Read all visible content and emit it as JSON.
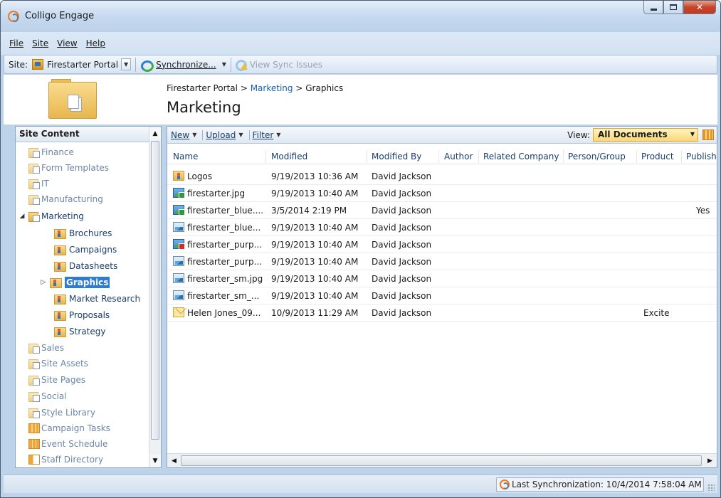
{
  "window": {
    "title": "Colligo Engage"
  },
  "menu": [
    {
      "label": "File"
    },
    {
      "label": "Site"
    },
    {
      "label": "View"
    },
    {
      "label": "Help"
    }
  ],
  "toolbar": {
    "site_label": "Site:",
    "site_value": "Firestarter Portal",
    "synchronize_label": "Synchronize...",
    "view_sync_issues_label": "View Sync Issues"
  },
  "header": {
    "breadcrumb": [
      "Firestarter Portal",
      "Marketing",
      "Graphics"
    ],
    "breadcrumb_sep": ">",
    "title": "Marketing"
  },
  "left_pane": {
    "header": "Site Content",
    "items": [
      {
        "label": "Finance"
      },
      {
        "label": "Form Templates"
      },
      {
        "label": "IT"
      },
      {
        "label": "Manufacturing"
      },
      {
        "label": "Marketing"
      },
      {
        "label": "Brochures"
      },
      {
        "label": "Campaigns"
      },
      {
        "label": "Datasheets"
      },
      {
        "label": "Graphics"
      },
      {
        "label": "Market Research"
      },
      {
        "label": "Proposals"
      },
      {
        "label": "Strategy"
      },
      {
        "label": "Sales"
      },
      {
        "label": "Site Assets"
      },
      {
        "label": "Site Pages"
      },
      {
        "label": "Social"
      },
      {
        "label": "Style Library"
      },
      {
        "label": "Campaign Tasks"
      },
      {
        "label": "Event Schedule"
      },
      {
        "label": "Staff Directory"
      }
    ]
  },
  "commands": {
    "new": "New",
    "upload": "Upload",
    "filter": "Filter",
    "view_label": "View:",
    "view_value": "All Documents"
  },
  "table": {
    "columns": [
      "Name",
      "Modified",
      "Modified By",
      "Author",
      "Related Company",
      "Person/Group",
      "Product",
      "Publish"
    ],
    "rows": [
      {
        "icon": "folder-icon",
        "name": "Logos",
        "modified": "9/19/2013 10:36 AM",
        "modified_by": "David Jackson",
        "product": "",
        "publish": ""
      },
      {
        "icon": "image-file-icon",
        "name": "firestarter.jpg",
        "modified": "9/19/2013 10:40 AM",
        "modified_by": "David Jackson",
        "product": "",
        "publish": ""
      },
      {
        "icon": "image-file-icon",
        "name": "firestarter_blue....",
        "modified": "3/5/2014 2:19 PM",
        "modified_by": "David Jackson",
        "product": "",
        "publish": "Yes"
      },
      {
        "icon": "image-file-icon",
        "name": "firestarter_blue...",
        "modified": "9/19/2013 10:40 AM",
        "modified_by": "David Jackson",
        "product": "",
        "publish": ""
      },
      {
        "icon": "image-file-icon",
        "name": "firestarter_purp...",
        "modified": "9/19/2013 10:40 AM",
        "modified_by": "David Jackson",
        "product": "",
        "publish": ""
      },
      {
        "icon": "image-file-icon",
        "name": "firestarter_purp...",
        "modified": "9/19/2013 10:40 AM",
        "modified_by": "David Jackson",
        "product": "",
        "publish": ""
      },
      {
        "icon": "image-file-icon",
        "name": "firestarter_sm.jpg",
        "modified": "9/19/2013 10:40 AM",
        "modified_by": "David Jackson",
        "product": "",
        "publish": ""
      },
      {
        "icon": "image-file-icon",
        "name": "firestarter_sm_...",
        "modified": "9/19/2013 10:40 AM",
        "modified_by": "David Jackson",
        "product": "",
        "publish": ""
      },
      {
        "icon": "email-file-icon",
        "name": "Helen Jones_09...",
        "modified": "10/9/2013 11:29 AM",
        "modified_by": "David Jackson",
        "product": "Excite",
        "publish": ""
      }
    ]
  },
  "status": {
    "last_sync": "Last Synchronization: 10/4/2014 7:58:04 AM"
  }
}
